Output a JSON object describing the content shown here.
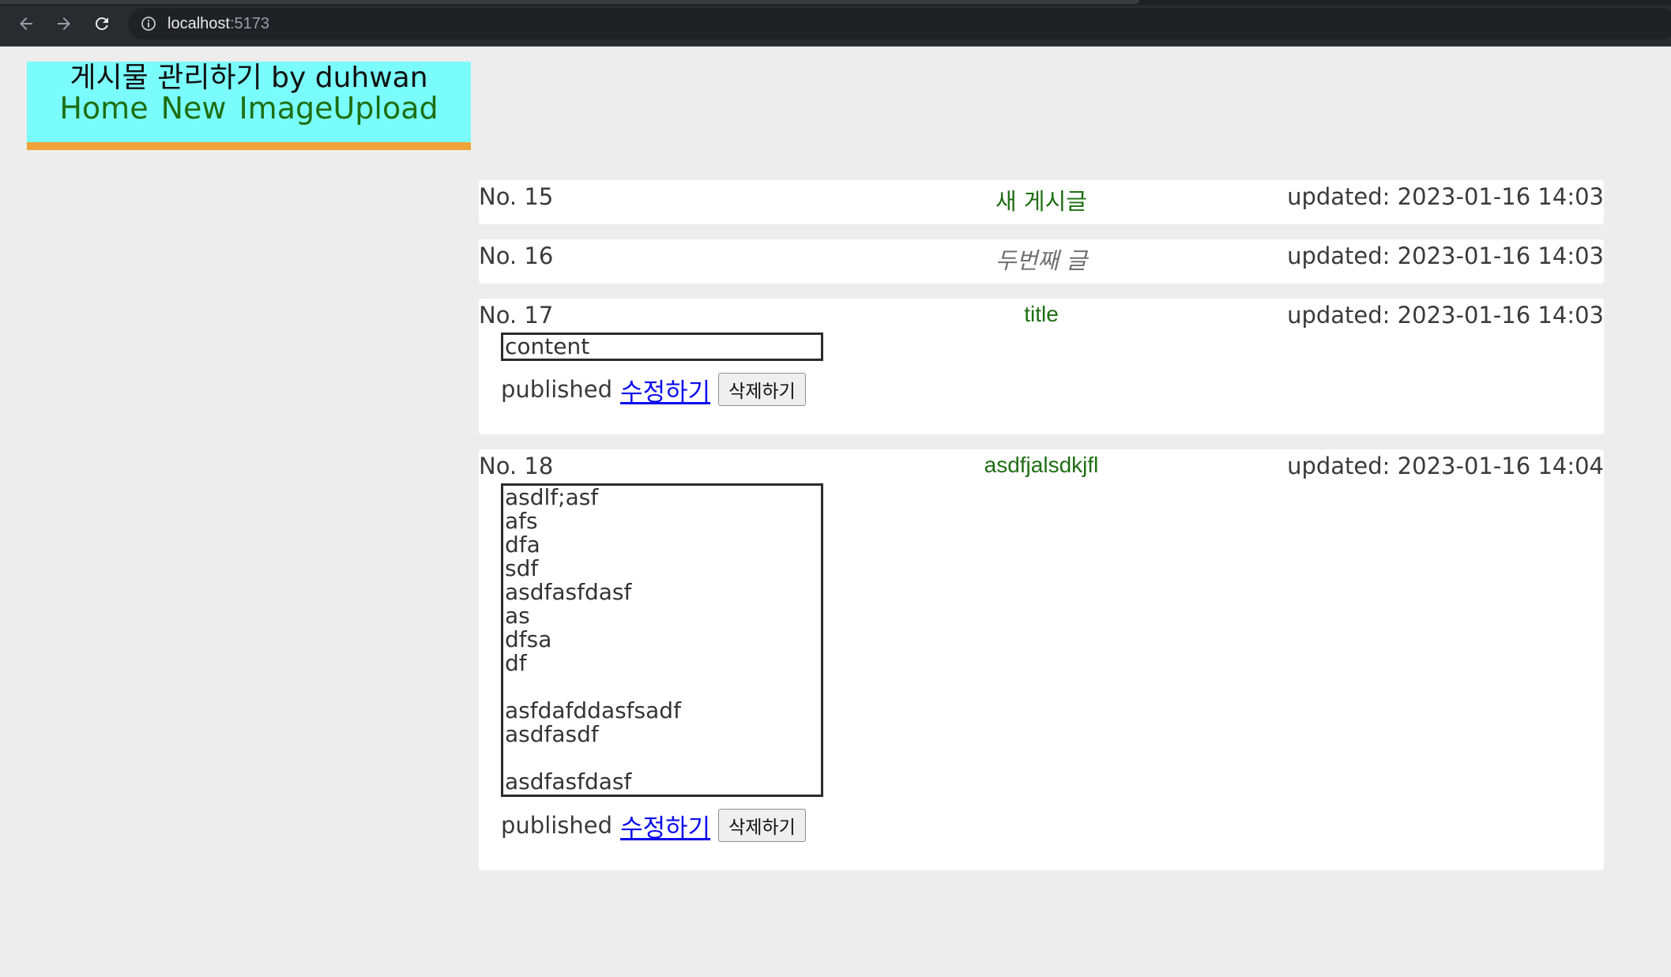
{
  "browser": {
    "url_host": "localhost",
    "url_port": ":5173"
  },
  "header": {
    "title": "게시물 관리하기 by duhwan",
    "nav": {
      "home": "Home",
      "new": "New",
      "image_upload": "ImageUpload"
    },
    "colors": {
      "background": "#7afcfc",
      "underline": "#f0a33a",
      "link": "#1e6e12"
    }
  },
  "posts": [
    {
      "no": "No. 15",
      "title": "새 게시글",
      "updated": "updated: 2023-01-16 14:03",
      "expanded": false
    },
    {
      "no": "No. 16",
      "title": "두번째 글",
      "updated": "updated: 2023-01-16 14:03",
      "expanded": false
    },
    {
      "no": "No. 17",
      "title": "title",
      "updated": "updated: 2023-01-16 14:03",
      "expanded": true,
      "content": "content",
      "status": "published",
      "edit_label": "수정하기",
      "delete_label": "삭제하기"
    },
    {
      "no": "No. 18",
      "title": "asdfjalsdkjfl",
      "updated": "updated: 2023-01-16 14:04",
      "expanded": true,
      "content": "asdlf;asf\nafs\ndfa\nsdf\nasdfasfdasf\nas\ndfsa\ndf\n\nasfdafddasfsadf\nasdfasdf\n\nasdfasfdasf",
      "status": "published",
      "edit_label": "수정하기",
      "delete_label": "삭제하기"
    }
  ]
}
